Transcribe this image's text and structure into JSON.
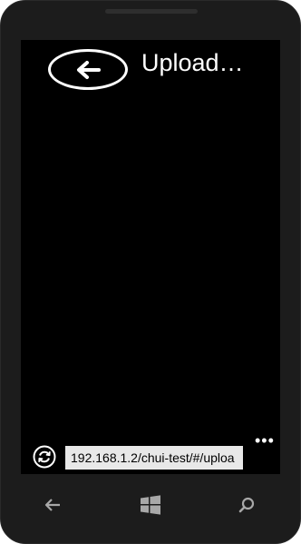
{
  "header": {
    "title": "Upload…",
    "back_icon": "arrow-left-icon"
  },
  "browser": {
    "url": "192.168.1.2/chui-test/#/uploa",
    "refresh_icon": "refresh-icon",
    "more_icon": "ellipsis-icon"
  },
  "hardware_keys": {
    "back_icon": "back-arrow-icon",
    "start_icon": "windows-start-icon",
    "search_icon": "search-icon"
  },
  "colors": {
    "screen_bg": "#000000",
    "bezel": "#1c1c1c",
    "foreground": "#ffffff",
    "url_bg": "#e8e8e8",
    "hardware_icon": "#a8a8a8"
  }
}
